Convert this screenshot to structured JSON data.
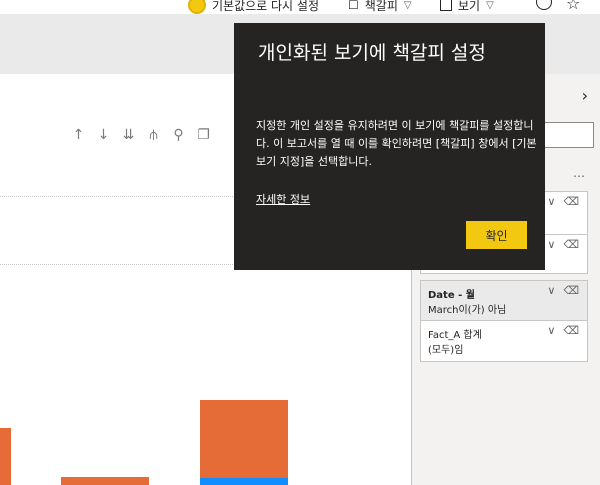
{
  "toolbar": {
    "reset_label": "기본값으로 다시 설정",
    "bookmark_label": "책갈피",
    "view_label": "보기"
  },
  "callout": {
    "title": "개인화된 보기에 책갈피 설정",
    "body": "지정한 개인 설정을 유지하려면 이 보기에 책갈피를 설정합니다. 이 보고서를 열 때 이를 확인하려면 [책갈피] 창에서 [기본 보기 지정]을 선택합니다.",
    "link": "자세한 정보",
    "confirm": "확인"
  },
  "filters": {
    "date_title": "Date - 월",
    "date_value": "March이(가) 아님",
    "fact_title": "Fact_A 합계",
    "fact_value": "(모두)임"
  },
  "chart_data": {
    "type": "bar",
    "stacked": true,
    "series_colors": [
      "#118dff",
      "#e66c37"
    ],
    "bars": [
      {
        "bottom_value": 0,
        "top_value": "partial"
      },
      {
        "bottom_value": 0,
        "top_value": "partial"
      },
      {
        "bottom_value": "partial",
        "top_value": "partial"
      }
    ]
  },
  "colors": {
    "accent": "#f2c811",
    "callout_bg": "#252423",
    "bar_orange": "#e66c37",
    "bar_blue": "#118dff"
  }
}
